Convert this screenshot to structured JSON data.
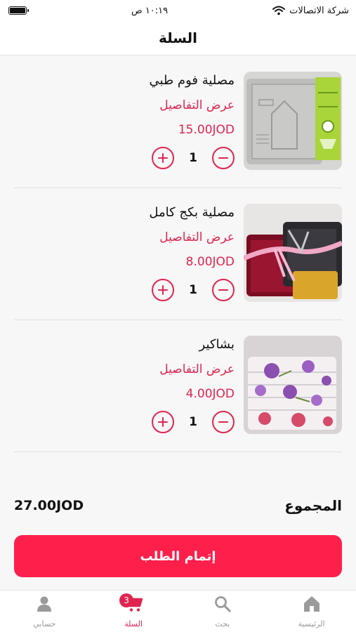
{
  "status_bar": {
    "carrier": "شركة الاتصالات",
    "time": "١٠:١٩ ص"
  },
  "header": {
    "title": "السلة"
  },
  "cart": {
    "items": [
      {
        "name": "مصلية فوم طبي",
        "details_label": "عرض التفاصيل",
        "price": "15.00JOD",
        "quantity": "1",
        "image": "gray-foam-prayer-mat"
      },
      {
        "name": "مصلية بكج كامل",
        "details_label": "عرض التفاصيل",
        "price": "8.00JOD",
        "quantity": "1",
        "image": "prayer-mat-gift-package"
      },
      {
        "name": "بشاكير",
        "details_label": "عرض التفاصيل",
        "price": "4.00JOD",
        "quantity": "1",
        "image": "stacked-floral-towels"
      }
    ]
  },
  "summary": {
    "total_label": "المجموع",
    "total_value": "27.00JOD"
  },
  "checkout": {
    "label": "إتمام الطلب"
  },
  "tab_bar": {
    "tabs": [
      {
        "label": "حسابي",
        "icon": "person-icon"
      },
      {
        "label": "السلة",
        "icon": "cart-icon",
        "badge": "3",
        "active": true
      },
      {
        "label": "بحث",
        "icon": "search-icon"
      },
      {
        "label": "الرئيسية",
        "icon": "home-icon"
      }
    ]
  },
  "colors": {
    "accent": "#e0244f",
    "button": "#ff1f4b",
    "inactive_tab": "#9a9a9a",
    "background": "#f7f7f7"
  }
}
